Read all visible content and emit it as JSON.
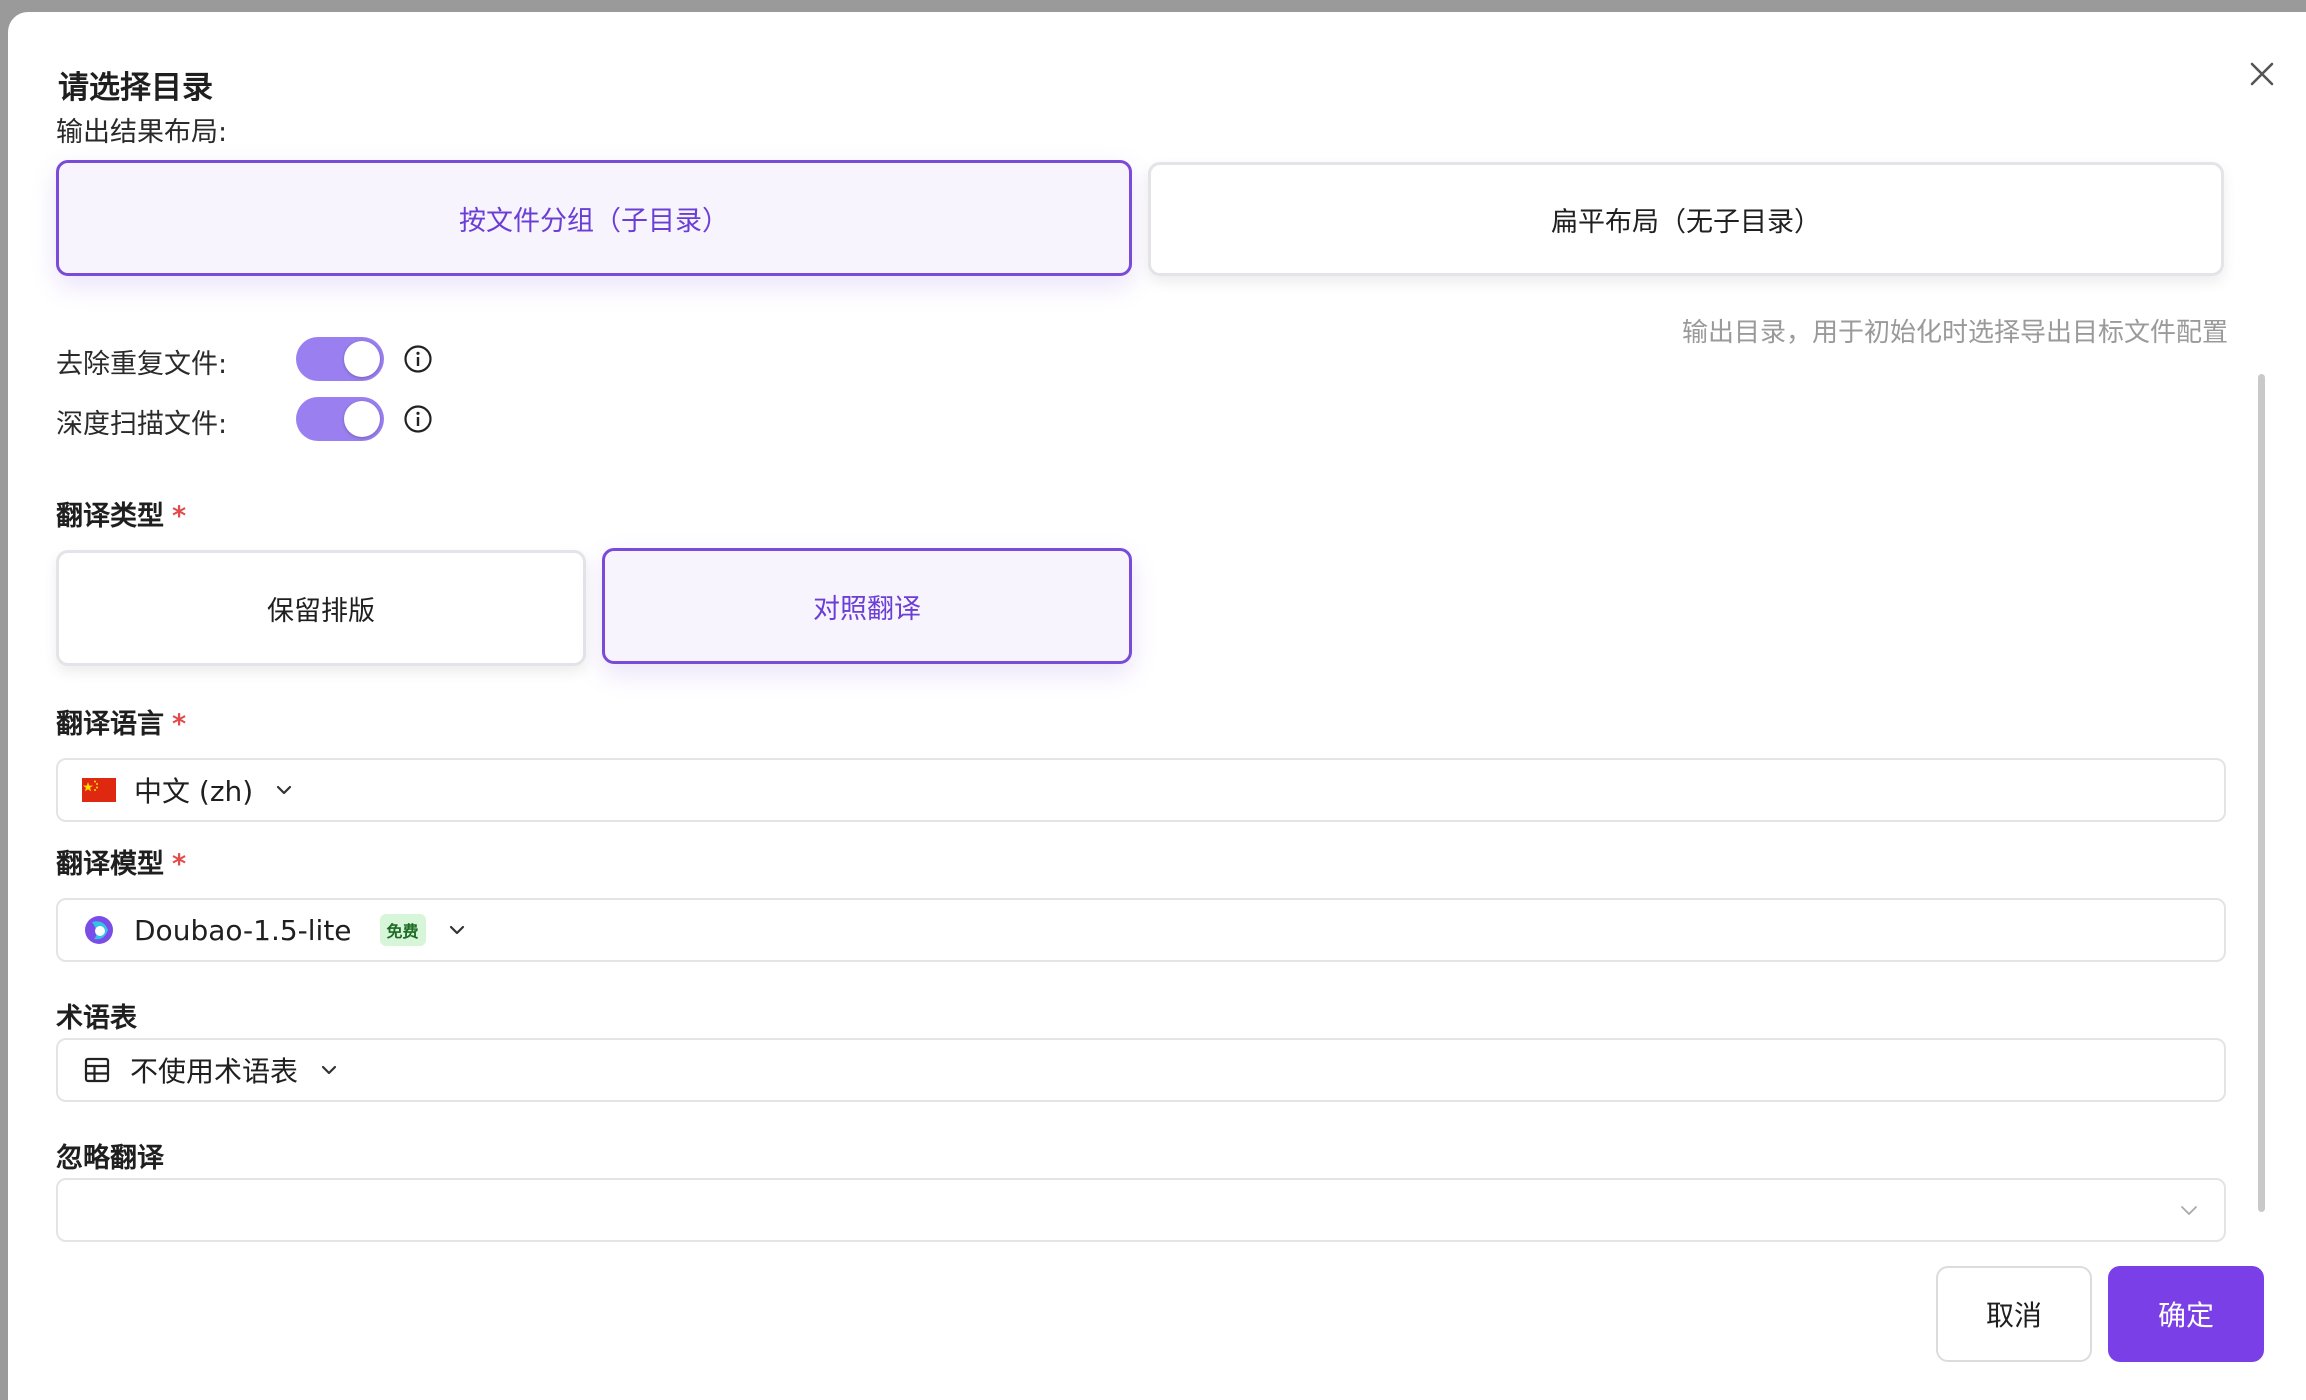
{
  "dialog": {
    "title": "请选择目录",
    "layout_label": "输出结果布局:",
    "layout_options": [
      "按文件分组（子目录）",
      "扁平布局（无子目录）"
    ],
    "hint": "输出目录，用于初始化时选择导出目标文件配置",
    "dedupe_label": "去除重复文件:",
    "deep_scan_label": "深度扫描文件:",
    "translate_type_label": "翻译类型",
    "translate_type_options": [
      "保留排版",
      "对照翻译"
    ],
    "language_label": "翻译语言",
    "language_value": "中文 (zh)",
    "model_label": "翻译模型",
    "model_value": "Doubao-1.5-lite",
    "model_badge": "免费",
    "glossary_label": "术语表",
    "glossary_value": "不使用术语表",
    "ignore_label": "忽略翻译",
    "ignore_value": "",
    "required_mark": "*",
    "cancel_label": "取消",
    "ok_label": "确定"
  },
  "colors": {
    "accent": "#7a3fe6",
    "toggle_on": "#9a7ff0",
    "required": "#e34b4b"
  },
  "icons": [
    "close-icon",
    "info-icon",
    "china-flag-icon",
    "doubao-logo-icon",
    "table-icon",
    "chevron-down-icon"
  ]
}
